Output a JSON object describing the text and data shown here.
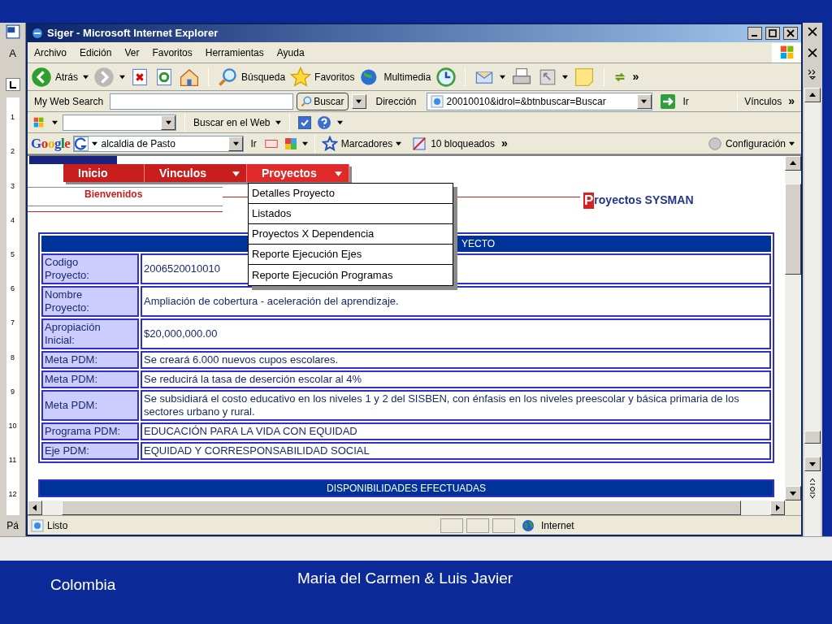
{
  "word": {
    "left_letter": "A",
    "ruler": [
      "1",
      "2",
      "3",
      "4",
      "5",
      "6",
      "7",
      "8",
      "9",
      "10",
      "11",
      "12"
    ],
    "page_label": "Pá"
  },
  "window": {
    "title": "Siger - Microsoft Internet Explorer"
  },
  "menu_bar": [
    "Archivo",
    "Edición",
    "Ver",
    "Favoritos",
    "Herramientas",
    "Ayuda"
  ],
  "toolbar": {
    "back": "Atrás",
    "search": "Búsqueda",
    "favorites": "Favoritos",
    "media": "Multimedia",
    "more": "»"
  },
  "address_bar": {
    "search_label": "My Web Search",
    "search_button": "Buscar",
    "address_label": "Dirección",
    "address": "20010010&idrol=&btnbuscar=Buscar",
    "go": "Ir",
    "links": "Vínculos",
    "more": "»"
  },
  "search_toolbar": {
    "button": "Buscar en el Web",
    "checked": true
  },
  "google_bar": {
    "logo": "Google",
    "query": "alcaldia de Pasto",
    "go": "Ir",
    "bookmarks": "Marcadores",
    "blocked": "10 bloqueados",
    "more": "»",
    "settings": "Configuración"
  },
  "page": {
    "nav": [
      {
        "label": "Inicio",
        "has_menu": false,
        "open": false
      },
      {
        "label": "Vinculos",
        "has_menu": true,
        "open": false
      },
      {
        "label": "Proyectos",
        "has_menu": true,
        "open": true,
        "menu": [
          "Detalles Proyecto",
          "Listados",
          "Proyectos X Dependencia",
          "Reporte Ejecución Ejes",
          "Reporte Ejecución Programas"
        ]
      }
    ],
    "welcome": "Bienvenidos",
    "brand_initial": "P",
    "brand_rest": "royectos SYSMAN",
    "table": {
      "header": "YECTO",
      "rows": [
        {
          "label": "Codigo Proyecto:",
          "value": "2006520010010"
        },
        {
          "label": "Nombre Proyecto:",
          "value": "Ampliación de cobertura - aceleración del aprendizaje."
        },
        {
          "label": "Apropiación Inicial:",
          "value": "$20,000,000.00"
        },
        {
          "label": "Meta PDM:",
          "value": "Se creará 6.000 nuevos cupos escolares."
        },
        {
          "label": "Meta PDM:",
          "value": "Se reducirá la tasa de deserción escolar al 4%"
        },
        {
          "label": "Meta PDM:",
          "value": "Se subsidiará el costo educativo en los niveles 1 y 2 del SISBEN, con énfasis en los niveles preescolar y básica primaria de los sectores urbano y rural."
        },
        {
          "label": "Programa PDM:",
          "value": "EDUCACIÓN PARA LA VIDA CON EQUIDAD"
        },
        {
          "label": "Eje PDM:",
          "value": "EQUIDAD Y CORRESPONSABILIDAD SOCIAL"
        }
      ]
    },
    "second_table_header": "DISPONIBILIDADES EFECTUADAS"
  },
  "status_bar": {
    "text": "Listo",
    "zone": "Internet"
  },
  "slide_footer": {
    "authors": "Maria del Carmen & Luis Javier",
    "country": "Colombia"
  }
}
